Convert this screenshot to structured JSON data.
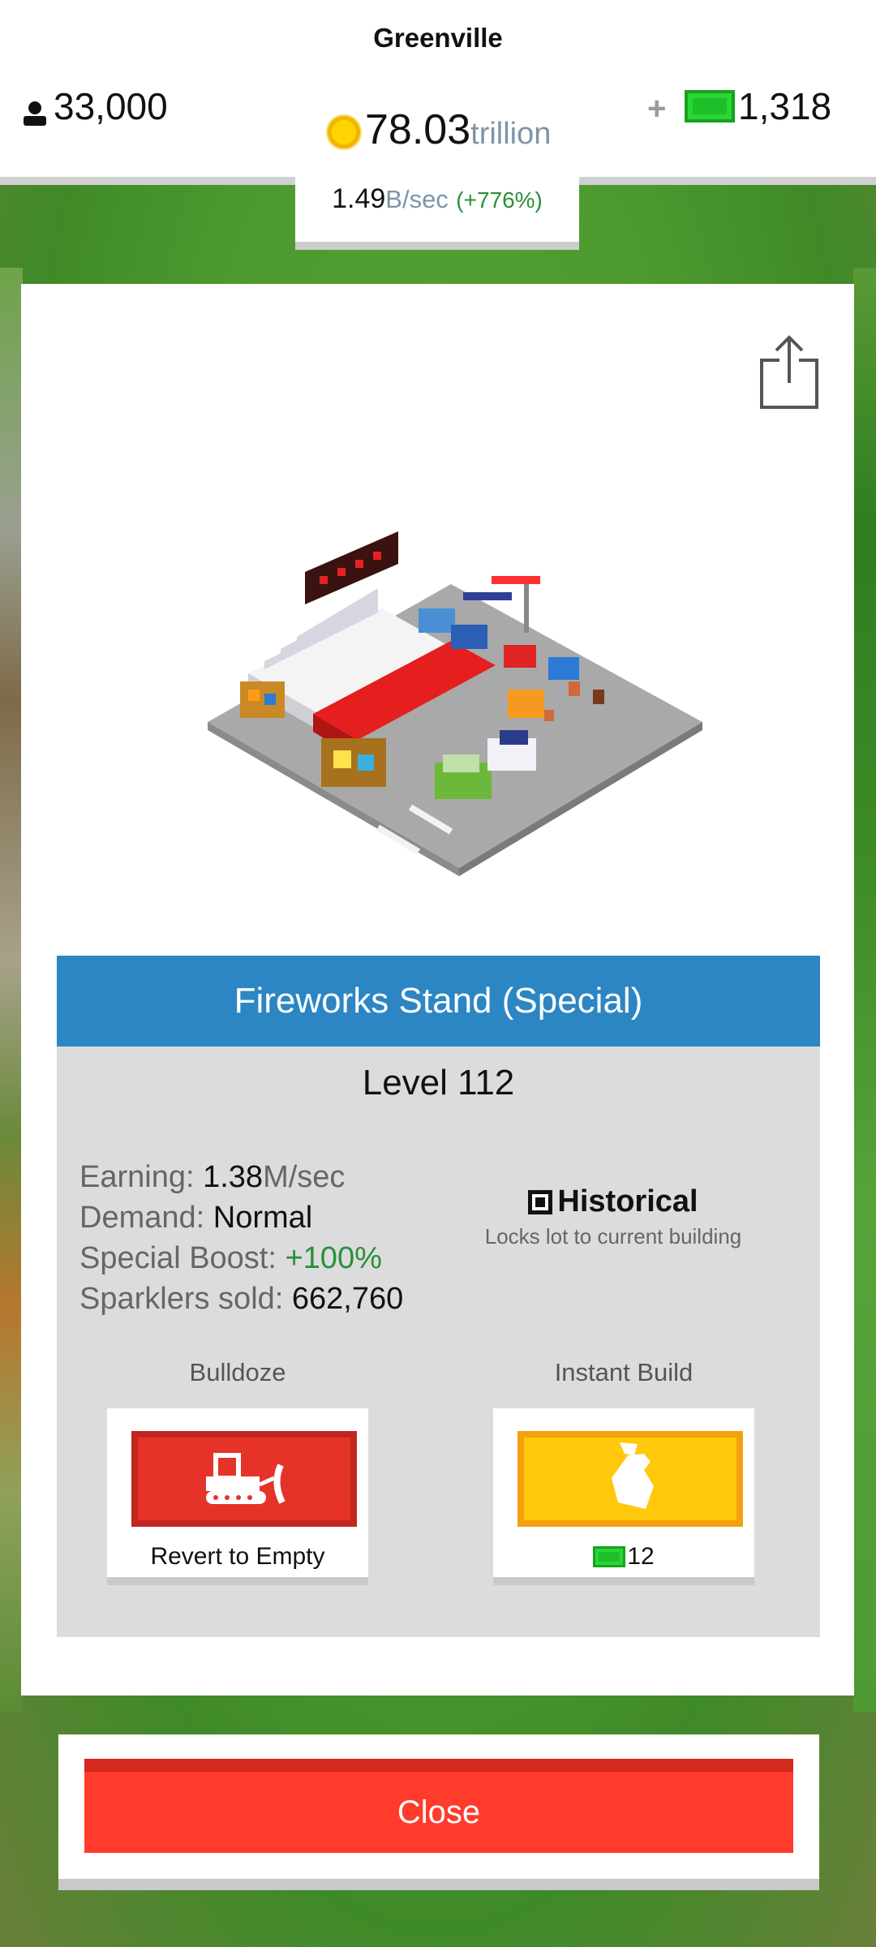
{
  "hud": {
    "city_name": "Greenville",
    "population": "33,000",
    "coins_value": "78.03",
    "coins_unit": "trillion",
    "cash_plus": "+",
    "cash": "1,318",
    "rate_value": "1.49",
    "rate_unit": "B/sec",
    "rate_change": "(+776%)"
  },
  "building": {
    "name": "Fireworks Stand (Special)",
    "level": "Level 112",
    "stats": [
      {
        "label": "Earning: ",
        "value": "1.38",
        "suffix": "M/sec"
      },
      {
        "label": "Demand: ",
        "value": "Normal"
      },
      {
        "label": "Special Boost: ",
        "value": "+100%"
      },
      {
        "label": "Sparklers sold: ",
        "value": "662,760"
      }
    ],
    "historical_title": "Historical",
    "historical_subtitle": "Locks lot to current building",
    "historical_checked": true
  },
  "actions": {
    "bulldoze_label": "Bulldoze",
    "bulldoze_text": "Revert to Empty",
    "instant_label": "Instant Build",
    "instant_cost": "12"
  },
  "close_label": "Close",
  "colors": {
    "header_blue": "#2b86c3",
    "close_red": "#ff3b2b",
    "bulldoze_red": "#e6332a",
    "instant_yellow": "#ffc80a",
    "positive_green": "#2a8f3a",
    "background_green": "#4c9a2f"
  },
  "icons": {
    "population": "person-icon",
    "coins": "coin-icon",
    "cash": "cash-icon",
    "share": "share-icon",
    "bulldoze": "bulldozer-icon",
    "instant": "hammer-icon",
    "historical": "checkbox-icon"
  }
}
